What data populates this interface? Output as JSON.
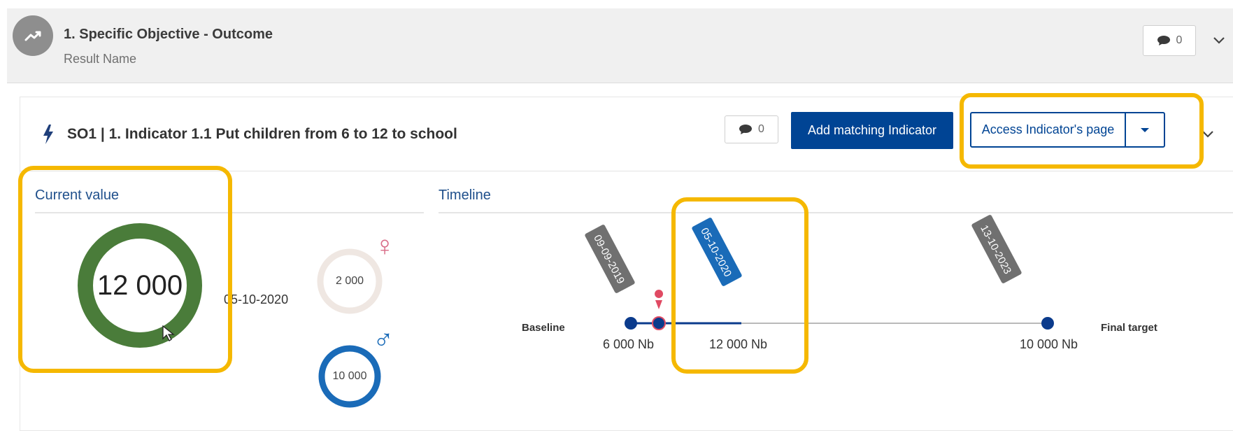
{
  "objective": {
    "title": "1. Specific Objective - Outcome",
    "subtitle": "Result Name",
    "comment_count": "0",
    "icon": "trending-up-icon"
  },
  "indicator": {
    "icon": "lightning-bolt-icon",
    "title": "SO1 | 1. Indicator 1.1 Put children from 6 to 12 to school",
    "comment_count": "0",
    "add_button_label": "Add matching Indicator",
    "access_button_label": "Access Indicator's page"
  },
  "current_value": {
    "title": "Current value",
    "value": "12 000",
    "date": "05-10-2020",
    "female_value": "2 000",
    "male_value": "10 000",
    "female_symbol": "♀",
    "male_symbol": "♂",
    "colors": {
      "main": "#4a7c3a",
      "female": "#efe7e2",
      "male": "#1a6bb8"
    }
  },
  "timeline": {
    "title": "Timeline",
    "baseline_label": "Baseline",
    "final_label": "Final target",
    "points": [
      {
        "date": "09-09-2019",
        "value": "6 000 Nb",
        "tag_color": "#707070"
      },
      {
        "date": "05-10-2020",
        "value": "12 000 Nb",
        "tag_color": "#1a6bb8"
      },
      {
        "date": "13-10-2023",
        "value": "10 000 Nb",
        "tag_color": "#707070"
      }
    ],
    "colors": {
      "progress": "#0b3b8c",
      "track": "#b9b9b9",
      "marker": "#e04a63"
    }
  }
}
